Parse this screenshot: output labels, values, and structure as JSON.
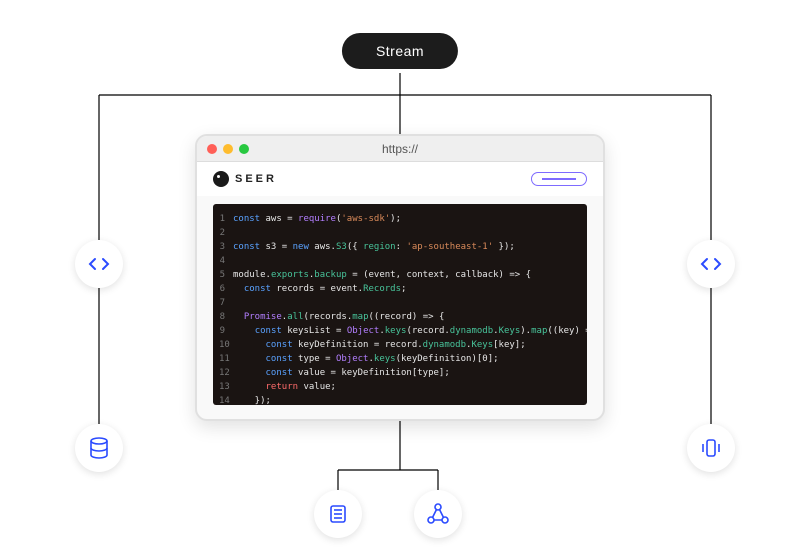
{
  "stream": {
    "label": "Stream"
  },
  "browser": {
    "url_label": "https://",
    "brand_text": "SEER"
  },
  "code_lines": [
    {
      "n": "1",
      "html": "<span class='kw'>const</span> aws = <span class='fn'>require</span>(<span class='str'>'aws-sdk'</span>);"
    },
    {
      "n": "2",
      "html": ""
    },
    {
      "n": "3",
      "html": "<span class='kw'>const</span> s3 = <span class='kw'>new</span> aws.<span class='prop'>S3</span>({ <span class='prop'>region</span>: <span class='str'>'ap-southeast-1'</span> });"
    },
    {
      "n": "4",
      "html": ""
    },
    {
      "n": "5",
      "html": "module.<span class='prop'>exports</span>.<span class='prop'>backup</span> = (event, context, callback) =&gt; {"
    },
    {
      "n": "6",
      "html": "  <span class='kw'>const</span> records = event.<span class='prop'>Records</span>;"
    },
    {
      "n": "7",
      "html": ""
    },
    {
      "n": "8",
      "html": "  <span class='fn'>Promise</span>.<span class='prop'>all</span>(records.<span class='prop'>map</span>((record) =&gt; {"
    },
    {
      "n": "9",
      "html": "    <span class='kw'>const</span> keysList = <span class='fn'>Object</span>.<span class='prop'>keys</span>(record.<span class='prop'>dynamodb</span>.<span class='prop'>Keys</span>).<span class='prop'>map</span>((key) =&gt; {"
    },
    {
      "n": "10",
      "html": "      <span class='kw'>const</span> keyDefinition = record.<span class='prop'>dynamodb</span>.<span class='prop'>Keys</span>[key];"
    },
    {
      "n": "11",
      "html": "      <span class='kw'>const</span> type = <span class='fn'>Object</span>.<span class='prop'>keys</span>(keyDefinition)[0];"
    },
    {
      "n": "12",
      "html": "      <span class='kw'>const</span> value = keyDefinition[type];"
    },
    {
      "n": "13",
      "html": "      <span class='ret'>return</span> value;"
    },
    {
      "n": "14",
      "html": "    });"
    }
  ],
  "nodes": {
    "code_left": {
      "icon": "code-icon"
    },
    "code_right": {
      "icon": "code-icon"
    },
    "database": {
      "icon": "database-icon"
    },
    "queue": {
      "icon": "stack-icon"
    },
    "server": {
      "icon": "server-icon"
    },
    "webhook": {
      "icon": "graph-icon"
    }
  },
  "colors": {
    "accent": "#2b4bff",
    "stream_bg": "#1c1c1c",
    "editor_bg": "#1a1412"
  }
}
